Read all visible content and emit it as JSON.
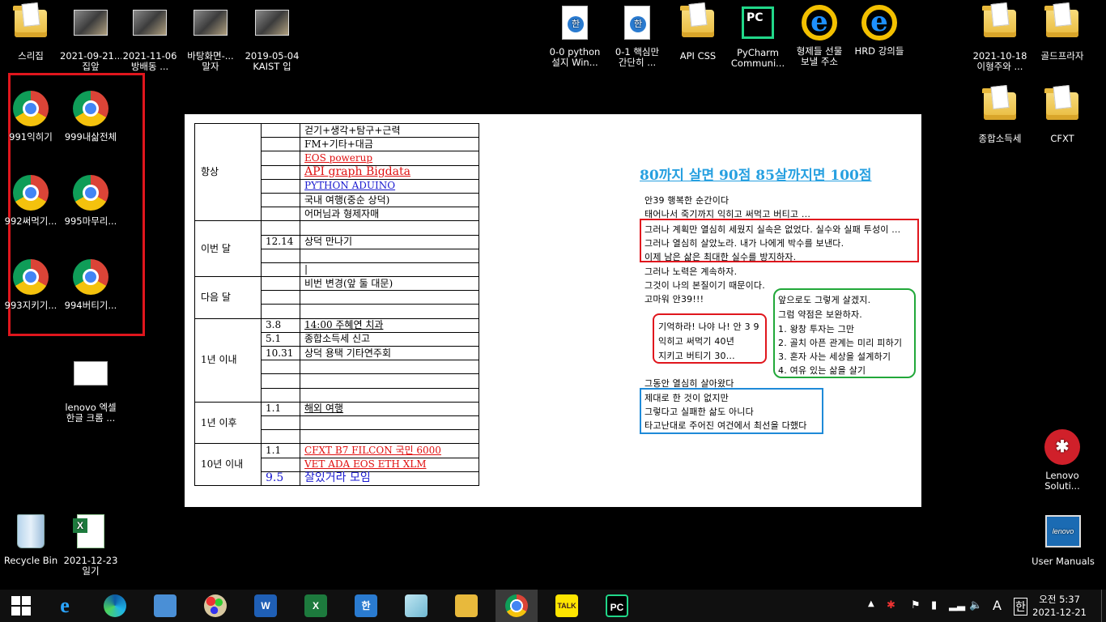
{
  "desktop_icons": {
    "top_left": [
      {
        "name": "스리집",
        "line2": ""
      },
      {
        "name": "2021-09-21...",
        "line2": "집앞"
      },
      {
        "name": "2021-11-06",
        "line2": "방배동 ..."
      },
      {
        "name": "바탕화면-...",
        "line2": "말자"
      },
      {
        "name": "2019-05-04",
        "line2": "KAIST 입"
      }
    ],
    "top_middle": [
      {
        "name": "0-0 python",
        "line2": "설지 Win..."
      },
      {
        "name": "0-1 핵심만",
        "line2": "간단히 ..."
      },
      {
        "name": "API CSS",
        "line2": ""
      },
      {
        "name": "PyCharm",
        "line2": "Communi..."
      },
      {
        "name": "형제들 선물",
        "line2": "보낼 주소"
      },
      {
        "name": "HRD 강의들",
        "line2": ""
      }
    ],
    "top_right": [
      {
        "name": "2021-10-18",
        "line2": "이형주와 ..."
      },
      {
        "name": "골드프라자",
        "line2": ""
      },
      {
        "name": "종합소득세",
        "line2": ""
      },
      {
        "name": "CFXT",
        "line2": ""
      }
    ],
    "chrome_shortcuts": [
      "991익히기",
      "999내삶전체",
      "992써먹기...",
      "995마무리...",
      "993지키기...",
      "994버티기..."
    ],
    "lenovo_excel": {
      "line1": "lenovo 엑셀",
      "line2": "한글 크롬 ..."
    },
    "recycle_bin": "Recycle Bin",
    "excel_file": {
      "line1": "2021-12-23",
      "line2": "일기"
    },
    "lenovo_solution": {
      "line1": "Lenovo",
      "line2": "Soluti..."
    },
    "user_manuals": "User Manuals"
  },
  "schedule": {
    "always_label": "항상",
    "always_items": [
      "걷기+생각+탐구+근력",
      "FM+기타+대금",
      "EOS powerup",
      "API graph Bigdata",
      "PYTHON ADUINO",
      "국내 여행(중순 상덕)",
      "어머님과 형제자매"
    ],
    "this_month_label": "이번 달",
    "this_month_date": "12.14",
    "this_month_item": "상덕 만나기",
    "next_month_label": "다음 달",
    "next_month_item": "비번 변경(앞 둘 대문)",
    "within_year_label": "1년 이내",
    "within_year": [
      {
        "date": "3.8",
        "text": "14:00 주혜연 치과"
      },
      {
        "date": "5.1",
        "text": "종합소득세 신고"
      },
      {
        "date": "10.31",
        "text": "상덕 용택 기타연주회"
      }
    ],
    "after_year_label": "1년 이후",
    "after_year_date": "1.1",
    "after_year_item": "해외 여행",
    "ten_year_label": "10년 이내",
    "ten_year": [
      {
        "date": "1.1",
        "text": "CFXT B7 FILCON 국민 6000"
      },
      {
        "date": "",
        "text": "VET ADA EOS ETH XLM"
      },
      {
        "date": "9.5",
        "text": "잘있거라 모임"
      }
    ]
  },
  "notes": {
    "heading": "80까지 살면 90점 85살까지면 100점",
    "intro": [
      "안39    행복한 순간이다",
      "태어나서 죽기까지 익히고 써먹고 버티고 ..."
    ],
    "red_box": [
      "그러나 계획만 열심히 세웠지 실속은 없었다. 실수와 실패 투성이 ...",
      "그러나 열심히 살았노라. 내가 나에게 박수를 보낸다.",
      "이제 남은 삶은 최대한 실수를 방지하자."
    ],
    "middle": [
      "그러나 노력은 계속하자.",
      "그것이 나의 본질이기 때문이다.",
      "고마워 안39!!!"
    ],
    "small_red_box": [
      "기억하라! 나야 나! 안 3 9",
      "익히고 써먹기 40년",
      "지키고 버티기 30..."
    ],
    "green_box": [
      "앞으로도 그렇게 살겠지.",
      "그럼 약점은 보완하자.",
      "1. 왕창 투자는 그만",
      "2. 골치 아픈 관계는 미리 피하기",
      "3. 혼자 사는 세상을 설계하기",
      "4. 여유 있는 삶을 살기"
    ],
    "after": "그동안 열심히 살아왔다",
    "blue_box": [
      "제대로 한 것이 없지만",
      "그렇다고 실패한 삶도 아니다",
      "타고난대로 주어진 여건에서 최선을 다했다"
    ]
  },
  "taskbar": {
    "apps": [
      "start",
      "internet-explorer",
      "edge",
      "control-panel",
      "paint",
      "word",
      "excel",
      "hwp",
      "notes",
      "file-explorer",
      "chrome",
      "kakaotalk",
      "pycharm"
    ],
    "kakao_label": "TALK",
    "pycharm_label": "PC",
    "ime": "A",
    "ime2": "한",
    "time": "오전 5:37",
    "date": "2021-12-21"
  },
  "colors": {
    "highlight_red": "#e0161d",
    "heading_blue": "#27a0e0",
    "green": "#22a83a",
    "blue_box": "#1e8ad8"
  }
}
